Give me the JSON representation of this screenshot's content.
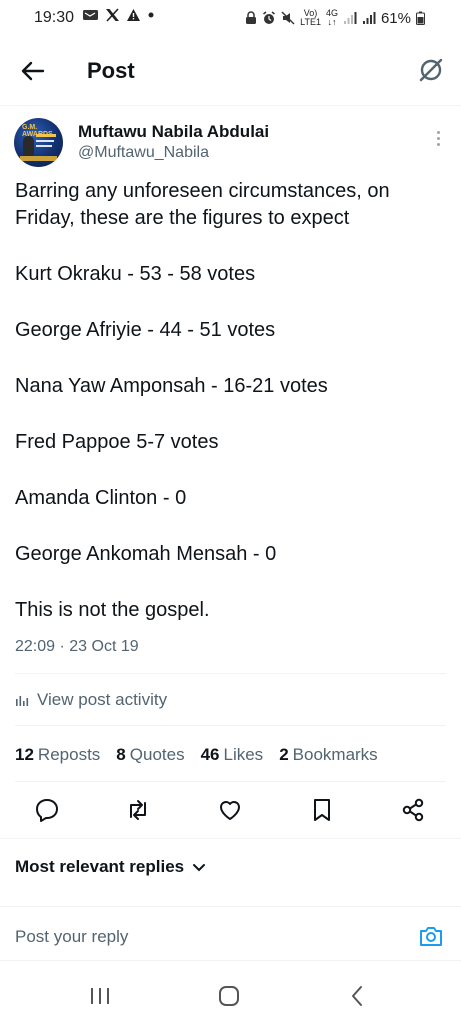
{
  "status_bar": {
    "time": "19:30",
    "battery_percent": "61%",
    "volte_top": "Vo)",
    "volte_bottom": "LTE1",
    "network_top": "4G",
    "network_bottom": "↓↑",
    "left_icons": [
      "message-icon",
      "x-logo-icon",
      "warning-icon",
      "dot-icon"
    ],
    "right_icons": [
      "lock-icon",
      "alarm-icon",
      "mute-icon",
      "signal-icon",
      "signal-icon",
      "battery-icon"
    ]
  },
  "header": {
    "title": "Post",
    "back_icon": "arrow-left-icon",
    "grok_icon": "grok-icon"
  },
  "post": {
    "author": {
      "display_name": "Muftawu Nabila Abdulai",
      "handle": "@Muftawu_Nabila",
      "avatar_title": "G.M. AWARDS"
    },
    "lines": [
      "Barring any unforeseen circumstances, on Friday, these are the figures to expect",
      "Kurt Okraku - 53 - 58 votes",
      "George Afriyie - 44 - 51 votes",
      "Nana Yaw Amponsah - 16-21 votes",
      "Fred Pappoe 5-7 votes",
      "Amanda Clinton - 0",
      "George Ankomah Mensah - 0",
      "This is not the gospel."
    ],
    "timestamp": "22:09 · 23 Oct 19",
    "activity_label": "View post activity",
    "stats": {
      "reposts": {
        "count": "12",
        "label": "Reposts"
      },
      "quotes": {
        "count": "8",
        "label": "Quotes"
      },
      "likes": {
        "count": "46",
        "label": "Likes"
      },
      "bookmarks": {
        "count": "2",
        "label": "Bookmarks"
      }
    }
  },
  "actions": [
    "reply-icon",
    "repost-icon",
    "like-icon",
    "bookmark-icon",
    "share-icon"
  ],
  "replies": {
    "sort_label": "Most relevant replies",
    "reply_placeholder": "Post your reply"
  },
  "nav_bar": [
    "recents-icon",
    "home-icon",
    "back-icon"
  ],
  "colors": {
    "text_primary": "#0f1419",
    "text_secondary": "#536471",
    "divider": "#eff3f4",
    "accent": "#1d9bf0"
  }
}
